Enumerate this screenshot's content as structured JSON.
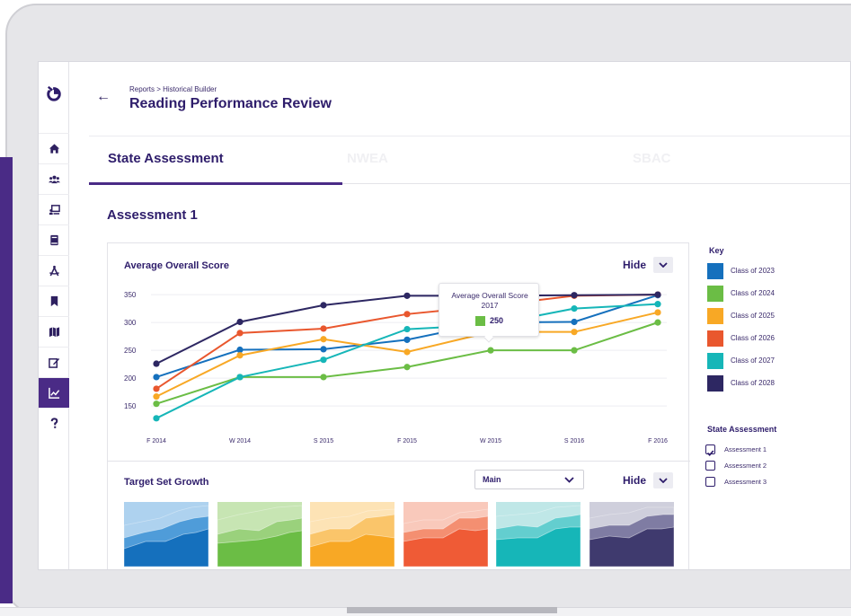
{
  "header": {
    "breadcrumb": "Reports > Historical Builder",
    "title": "Reading Performance Review"
  },
  "tabs": [
    {
      "label": "State Assessment",
      "active": true
    },
    {
      "label": "NWEA",
      "active": false
    },
    {
      "label": "SBAC",
      "active": false
    }
  ],
  "section_title": "Assessment 1",
  "sidebar": {
    "items": [
      {
        "icon": "home-icon"
      },
      {
        "icon": "users-icon"
      },
      {
        "icon": "presentation-icon"
      },
      {
        "icon": "book-icon"
      },
      {
        "icon": "compass-icon"
      },
      {
        "icon": "bookmark-icon"
      },
      {
        "icon": "map-icon"
      },
      {
        "icon": "edit-icon"
      },
      {
        "icon": "chart-line-icon",
        "active": true
      },
      {
        "icon": "help-icon"
      }
    ]
  },
  "score_card": {
    "title": "Average Overall Score",
    "hide_label": "Hide"
  },
  "growth_card": {
    "title": "Target Set Growth",
    "dropdown_value": "Main",
    "hide_label": "Hide"
  },
  "tooltip": {
    "title_line1": "Average Overall Score",
    "title_line2": "2017",
    "value": "250",
    "color": "#6bbd45"
  },
  "chart_data": {
    "type": "line",
    "title": "Average Overall Score",
    "categories": [
      "F 2014",
      "W 2014",
      "S 2015",
      "F 2015",
      "W 2015",
      "S 2016",
      "F 2016"
    ],
    "yticks": [
      150,
      200,
      250,
      300,
      350
    ],
    "ylim": [
      110,
      355
    ],
    "grid": true,
    "series": [
      {
        "name": "Class of 2023",
        "color": "#1570bd",
        "values": [
          202,
          251,
          252,
          269,
          300,
          301,
          349
        ]
      },
      {
        "name": "Class of 2024",
        "color": "#6bbd45",
        "values": [
          154,
          202,
          202,
          220,
          250,
          250,
          300
        ]
      },
      {
        "name": "Class of 2025",
        "color": "#f8a825",
        "values": [
          167,
          241,
          270,
          247,
          283,
          283,
          318
        ]
      },
      {
        "name": "Class of 2026",
        "color": "#e9572e",
        "values": [
          181,
          281,
          289,
          315,
          330,
          348,
          350
        ]
      },
      {
        "name": "Class of 2027",
        "color": "#16b6b8",
        "values": [
          128,
          202,
          233,
          288,
          296,
          325,
          333
        ]
      },
      {
        "name": "Class of 2028",
        "color": "#2d2762",
        "values": [
          226,
          301,
          331,
          348,
          348,
          349,
          350
        ]
      }
    ]
  },
  "key": {
    "title": "Key",
    "items": [
      {
        "label": "Class of 2023",
        "color": "#1570bd"
      },
      {
        "label": "Class of 2024",
        "color": "#6bbd45"
      },
      {
        "label": "Class of 2025",
        "color": "#f8a825"
      },
      {
        "label": "Class of 2026",
        "color": "#e9572e"
      },
      {
        "label": "Class of 2027",
        "color": "#16b6b8"
      },
      {
        "label": "Class of 2028",
        "color": "#2d2762"
      }
    ]
  },
  "state_assessment": {
    "title": "State Assessment",
    "items": [
      {
        "label": "Assessment 1",
        "checked": true
      },
      {
        "label": "Assessment 2",
        "checked": false
      },
      {
        "label": "Assessment 3",
        "checked": false
      }
    ]
  },
  "growth_tiles": [
    {
      "color": "#1570bd",
      "light": "#aed2ef",
      "mid": "#4a9ad8"
    },
    {
      "color": "#6bbd45",
      "light": "#c7e5b3",
      "mid": "#98d07a"
    },
    {
      "color": "#f8a825",
      "light": "#fde3b5",
      "mid": "#fac466"
    },
    {
      "color": "#ef5b36",
      "light": "#f9c9bb",
      "mid": "#f48c6e"
    },
    {
      "color": "#16b6b8",
      "light": "#bfe7e7",
      "mid": "#5fcdce"
    },
    {
      "color": "#3f3a6e",
      "light": "#cfcfdc",
      "mid": "#7b78a0"
    }
  ]
}
